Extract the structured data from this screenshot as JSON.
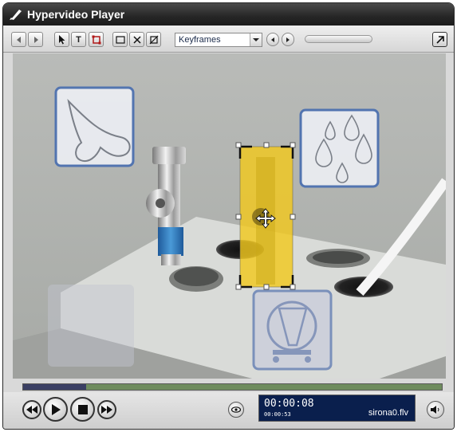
{
  "window": {
    "title": "Hypervideo Player"
  },
  "toolbar": {
    "buttons": [
      {
        "name": "back-button",
        "icon": "triangle-left-icon"
      },
      {
        "name": "forward-button",
        "icon": "triangle-right-icon"
      },
      {
        "name": "select-tool-button",
        "icon": "cursor-arrow-icon"
      },
      {
        "name": "text-tool-button",
        "icon": "text-T-icon",
        "glyph": "T"
      },
      {
        "name": "hotspot-tool-button",
        "icon": "hotspot-frame-icon"
      },
      {
        "name": "rectangle-tool-button",
        "icon": "rectangle-icon"
      },
      {
        "name": "delete-button",
        "icon": "x-icon"
      },
      {
        "name": "clear-hotspot-button",
        "icon": "crossed-box-icon"
      }
    ],
    "mode_select": {
      "value": "Keyframes"
    },
    "prev_keyframe_icon": "chevron-left-icon",
    "next_keyframe_icon": "chevron-right-icon",
    "popout_icon": "arrow-up-right-icon"
  },
  "playback": {
    "progress_fraction": 0.15,
    "time": "00:00:08",
    "time_small": "00:00:53",
    "filename": "sirona0.flv"
  },
  "colors": {
    "hotspot_fill": "#f2c81e",
    "overlay_blue": "#4a6fb0",
    "seek_played": "#3a3f63",
    "seek_track": "#6f8c5e",
    "display_bg": "#0a1f4d"
  }
}
